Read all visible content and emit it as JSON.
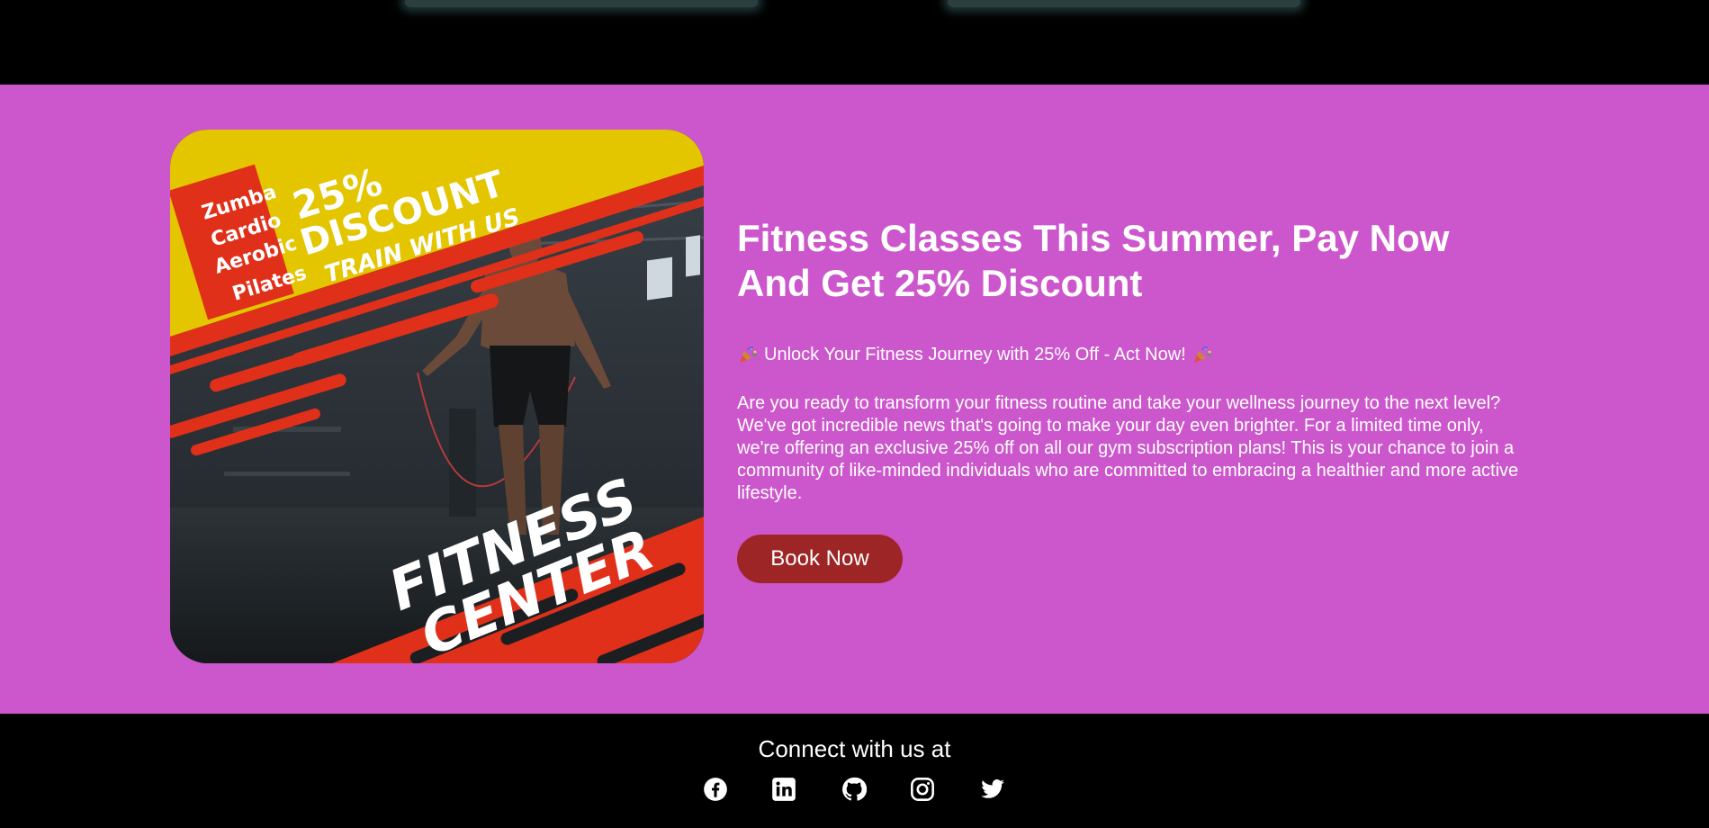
{
  "promo": {
    "headline": "Fitness Classes This Summer, Pay Now And Get 25% Discount",
    "tagline": "Unlock Your Fitness Journey with 25% Off - Act Now!",
    "body": "Are you ready to transform your fitness routine and take your wellness journey to the next level? We've got incredible news that's going to make your day even brighter. For a limited time only, we're offering an exclusive 25% off on all our gym subscription plans! This is your chance to join a community of like-minded individuals who are committed to embracing a healthier and more active lifestyle.",
    "cta_label": "Book Now",
    "poster": {
      "classes": [
        "Zumba",
        "Cardio",
        "Aerobic",
        "Pilates"
      ],
      "discount_pct": "25%",
      "discount_word": "DISCOUNT",
      "train": "TRAIN WITH US",
      "fitness": "FITNESS",
      "center": "CENTER"
    }
  },
  "footer": {
    "connect_label": "Connect with us at",
    "socials": [
      "facebook-icon",
      "linkedin-icon",
      "github-icon",
      "instagram-icon",
      "twitter-icon"
    ]
  },
  "colors": {
    "promo_bg": "#cc57cc",
    "cta_bg": "#9e2525",
    "poster_red": "#e0301a",
    "poster_yellow": "#e3c500",
    "footer_bg": "#000000"
  }
}
